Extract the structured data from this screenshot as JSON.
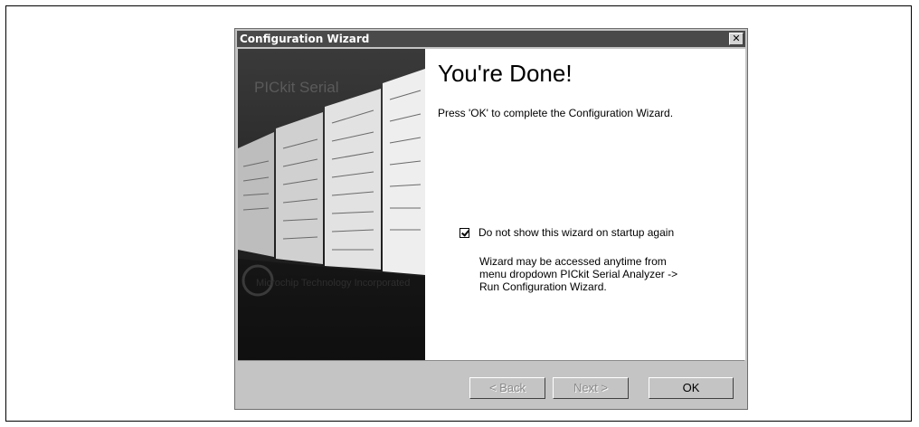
{
  "window": {
    "title": "Configuration Wizard",
    "close_glyph": "✕"
  },
  "art": {
    "brand": "PICkit Serial",
    "company": "Microchip Technology Incorporated"
  },
  "content": {
    "heading": "You're Done!",
    "subtext": "Press 'OK' to complete the Configuration Wizard.",
    "checkbox_label": "Do not show this wizard on startup again",
    "checkbox_checked": true,
    "note_lines": [
      "Wizard may be accessed anytime from",
      "menu dropdown PICkit Serial Analyzer ->",
      "Run Configuration Wizard."
    ]
  },
  "buttons": {
    "back": "< Back",
    "next": "Next >",
    "ok": "OK"
  }
}
